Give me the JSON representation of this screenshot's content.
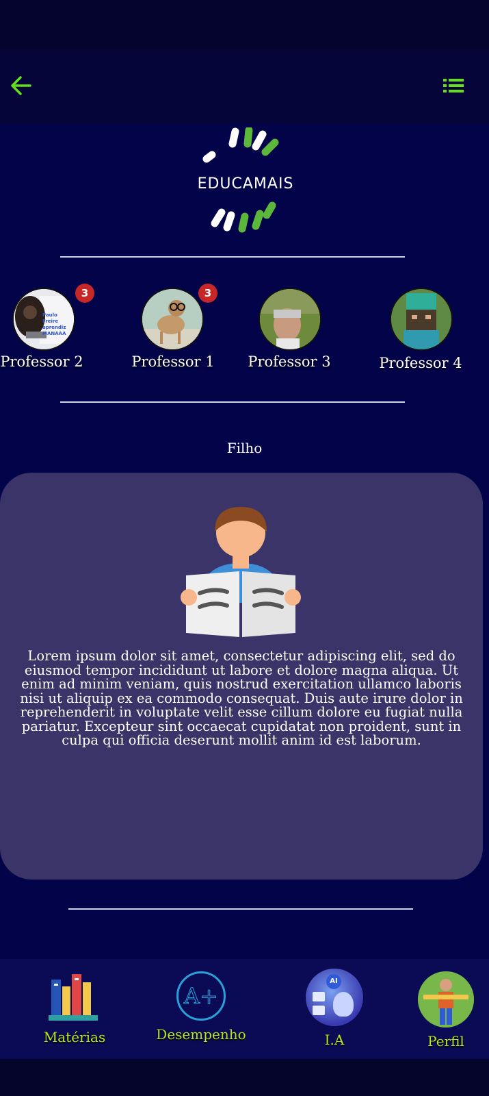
{
  "app": {
    "logo_text": "EDUCAMAIS"
  },
  "header": {
    "back_icon": "arrow-left-icon",
    "menu_icon": "list-menu-icon",
    "accent_color": "#62e01c"
  },
  "teachers": [
    {
      "name": "Professor 2",
      "badge": "3",
      "avatar_caption_1": "Paulo Freire",
      "avatar_caption_2": "aprendiz MANAAA"
    },
    {
      "name": "Professor 1",
      "badge": "3"
    },
    {
      "name": "Professor 3",
      "badge": ""
    },
    {
      "name": "Professor 4",
      "badge": ""
    }
  ],
  "child": {
    "title": "Filho",
    "description": "Lorem ipsum dolor sit amet, consectetur adipiscing elit, sed do eiusmod tempor incididunt ut labore et dolore magna aliqua. Ut enim ad minim veniam, quis nostrud exercitation ullamco laboris nisi ut aliquip ex ea commodo consequat. Duis aute irure dolor in reprehenderit in voluptate velit esse cillum dolore eu fugiat nulla pariatur. Excepteur sint occaecat cupidatat non proident, sunt in culpa qui officia deserunt mollit anim id est laborum."
  },
  "nav": {
    "items": [
      {
        "label": "Matérias",
        "icon": "books-icon"
      },
      {
        "label": "Desempenho",
        "icon": "grade-a-plus-icon",
        "icon_text": "A+"
      },
      {
        "label": "I.A",
        "icon": "ai-robot-icon",
        "icon_text": "AI"
      },
      {
        "label": "Perfil",
        "icon": "profile-avatar-icon"
      }
    ],
    "label_color": "#b4e61e"
  }
}
